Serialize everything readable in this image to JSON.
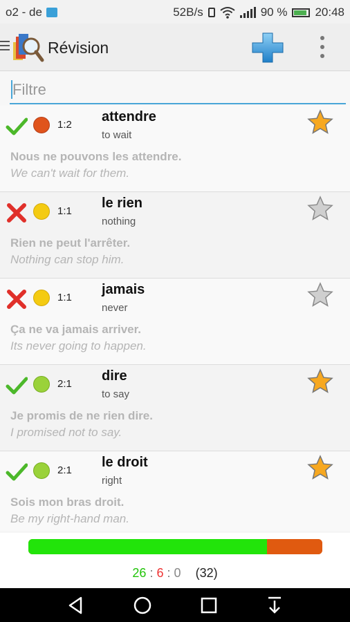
{
  "status_bar": {
    "carrier": "o2 - de",
    "speed": "52B/s",
    "battery": "90 %",
    "time": "20:48"
  },
  "app_bar": {
    "title": "Révision",
    "icons": [
      "menu-icon",
      "app-logo-icon",
      "add-icon",
      "overflow-menu-icon"
    ]
  },
  "filter": {
    "placeholder": "Filtre",
    "value": ""
  },
  "cards": [
    {
      "word": "attendre",
      "translation": "to wait",
      "score": "1:2",
      "result": "correct",
      "level_color": "#e0541c",
      "starred": true,
      "example": "Nous ne pouvons les attendre.",
      "example_translation": "We can't wait for them."
    },
    {
      "word": "le rien",
      "translation": "nothing",
      "score": "1:1",
      "result": "wrong",
      "level_color": "#f4cb12",
      "starred": false,
      "example": "Rien ne peut l'arrêter.",
      "example_translation": "Nothing can stop him."
    },
    {
      "word": "jamais",
      "translation": "never",
      "score": "1:1",
      "result": "wrong",
      "level_color": "#f4cb12",
      "starred": false,
      "example": "Ça ne va jamais arriver.",
      "example_translation": "Its never going to happen."
    },
    {
      "word": "dire",
      "translation": "to say",
      "score": "2:1",
      "result": "correct",
      "level_color": "#9ad23a",
      "starred": true,
      "example": "Je promis de ne rien dire.",
      "example_translation": "I promised not to say."
    },
    {
      "word": "le droit",
      "translation": "right",
      "score": "2:1",
      "result": "correct",
      "level_color": "#9ad23a",
      "starred": true,
      "example": "Sois mon bras droit.",
      "example_translation": "Be my right-hand man."
    }
  ],
  "progress": {
    "correct": 26,
    "wrong": 6,
    "unknown": 0,
    "total": 32,
    "colors": {
      "correct": "#22e40a",
      "wrong": "#e05a10"
    }
  },
  "counts": {
    "correct": "26",
    "wrong": "6",
    "unknown": "0",
    "total": "(32)",
    "sep": ":"
  },
  "nav_bar": {
    "icons": [
      "back-icon",
      "home-icon",
      "recents-icon",
      "notification-pull-icon"
    ]
  }
}
